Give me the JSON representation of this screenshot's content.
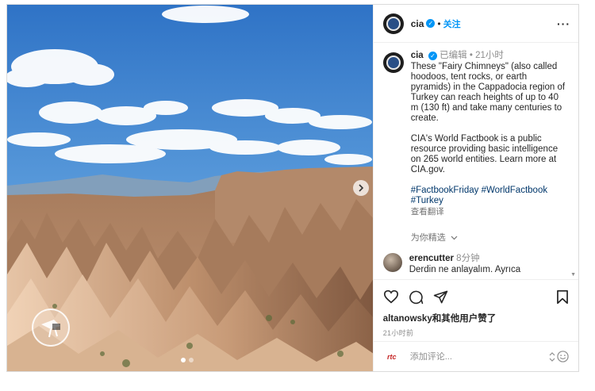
{
  "post": {
    "username": "cia",
    "follow_label": "关注",
    "separator": "•",
    "more_label": "···"
  },
  "caption": {
    "username": "cia",
    "edited_label": "已编辑",
    "separator": "•",
    "time": "21小时",
    "text": "These \"Fairy Chimneys\" (also called hoodoos, tent rocks, or earth pyramids) in the Cappadocia region of Turkey can reach heights of up to 40 m (130 ft) and take many centuries to create.\n\nCIA's World Factbook is a public resource providing basic intelligence on 265 world entities. Learn more at CIA.gov.\n\n",
    "tags": "#FactbookFriday #WorldFactbook #Turkey",
    "translate": "查看翻译"
  },
  "for_you": "为你精选",
  "comment": {
    "username": "erencutter",
    "time": "8分钟",
    "text": "Derdin ne anlayalım. Ayrıca"
  },
  "likes": {
    "user": "altanowsky",
    "rest": "和其他用户赞了"
  },
  "post_time": "21小时前",
  "add_comment": {
    "placeholder": "添加评论..."
  },
  "icons": {
    "like": "heart-icon",
    "comment": "comment-icon",
    "share": "paper-plane-icon",
    "save": "bookmark-icon",
    "emoji": "emoji-icon"
  },
  "colors": {
    "link_blue": "#0095f6",
    "hashtag": "#00376b",
    "muted": "#8e8e8e"
  }
}
